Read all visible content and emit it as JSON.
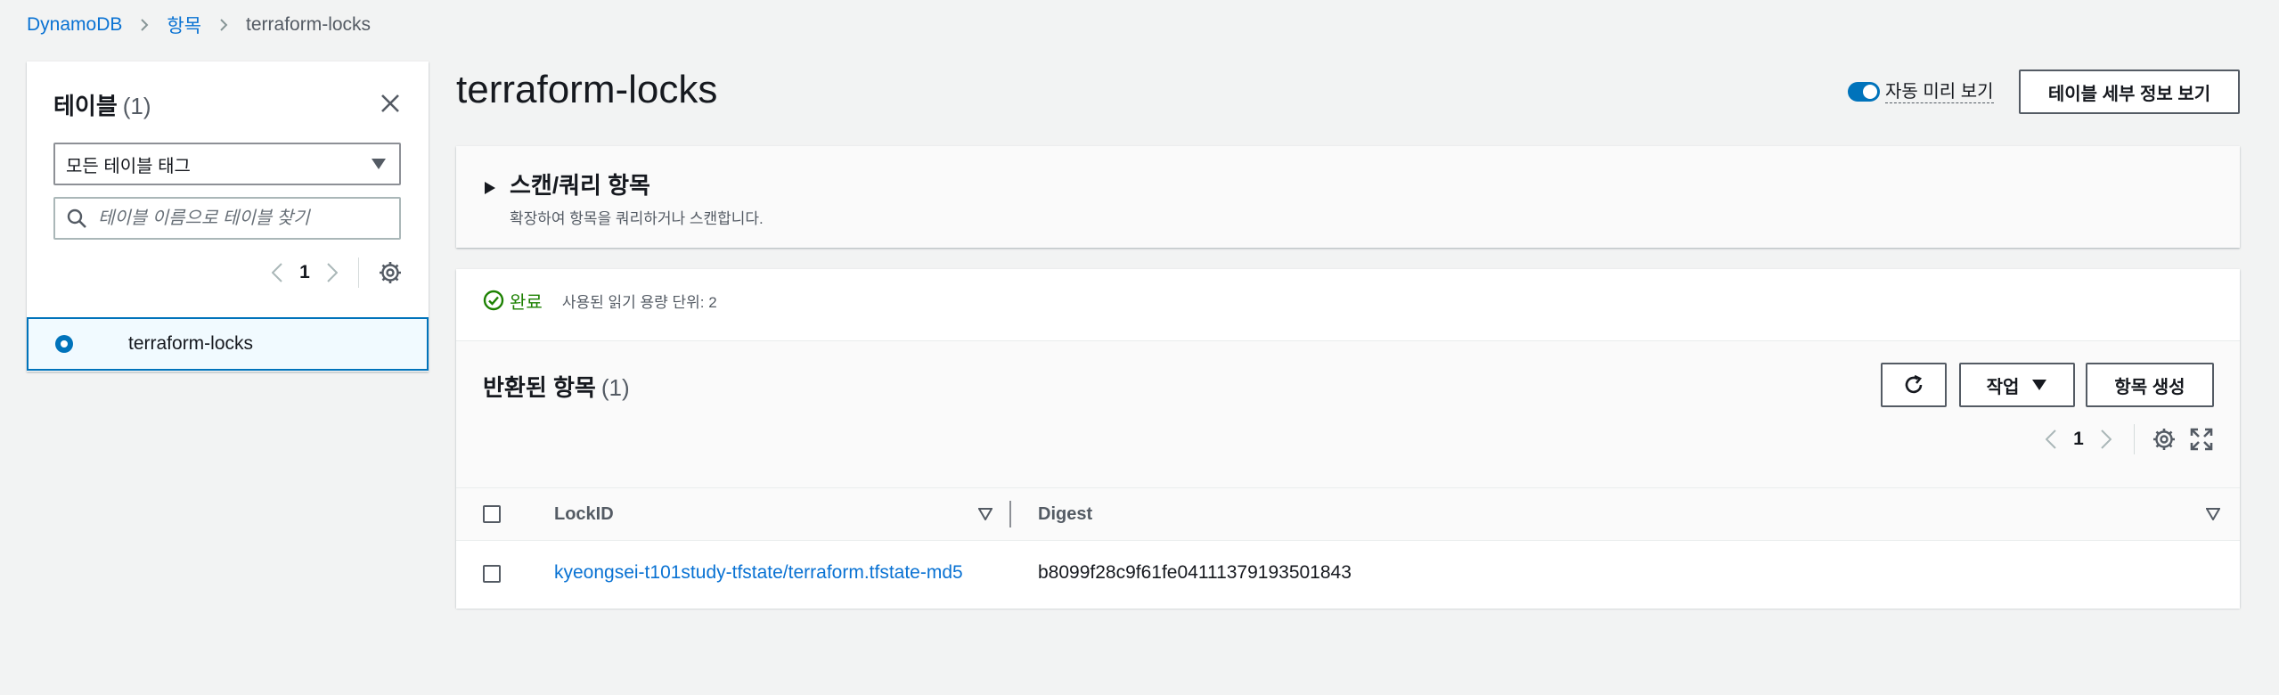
{
  "breadcrumb": {
    "items": [
      "DynamoDB",
      "항목"
    ],
    "current": "terraform-locks"
  },
  "sidebar": {
    "title": "테이블",
    "count": "(1)",
    "tag_filter": "모든 테이블 태그",
    "search_placeholder": "테이블 이름으로 테이블 찾기",
    "page": "1",
    "tables": [
      {
        "name": "terraform-locks",
        "selected": true
      }
    ]
  },
  "header": {
    "title": "terraform-locks",
    "auto_preview_label": "자동 미리 보기",
    "auto_preview_on": true,
    "details_button": "테이블 세부 정보 보기"
  },
  "scan_panel": {
    "title": "스캔/쿼리 항목",
    "description": "확장하여 항목을 쿼리하거나 스캔합니다."
  },
  "results": {
    "status": "완료",
    "status_meta": "사용된 읽기 용량 단위: 2",
    "title": "반환된 항목",
    "count": "(1)",
    "actions_label": "작업",
    "create_label": "항목 생성",
    "page": "1",
    "columns": [
      "LockID",
      "Digest"
    ],
    "rows": [
      {
        "LockID": "kyeongsei-t101study-tfstate/terraform.tfstate-md5",
        "Digest": "b8099f28c9f61fe04111379193501843"
      }
    ]
  },
  "colors": {
    "link": "#0972d3",
    "primary": "#0073bb",
    "success": "#1d8102",
    "background": "#f2f3f3"
  }
}
